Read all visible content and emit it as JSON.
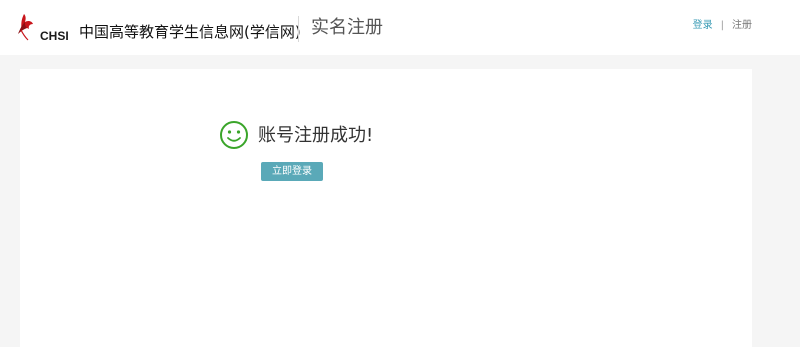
{
  "header": {
    "logo_text": "CHSI",
    "site_name": "中国高等教育学生信息网(学信网)",
    "page_title": "实名注册",
    "nav": {
      "login_label": "登录",
      "separator": "|",
      "register_label": "注册"
    }
  },
  "main": {
    "success_message": "账号注册成功!",
    "login_button_label": "立即登录"
  },
  "colors": {
    "accent": "#5aa9b8",
    "link": "#3a9bb5",
    "success_icon": "#3aa52a",
    "logo_red": "#c8151b"
  },
  "icons": {
    "logo": "chsi-bird-logo",
    "success": "smiley-face-icon"
  }
}
